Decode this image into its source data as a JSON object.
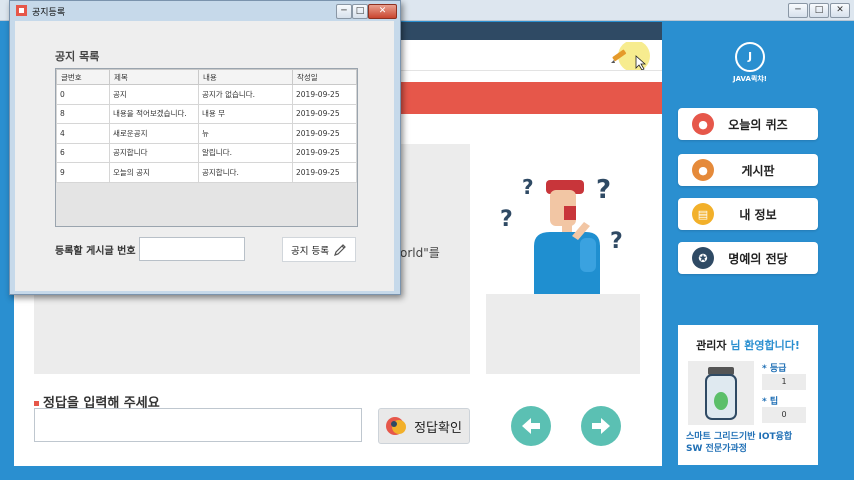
{
  "main_window": {
    "title_buttons": [
      "─",
      "□",
      "✕"
    ],
    "question_fragment": "orld\"를",
    "answer_label": "정답을 입력해 주세요",
    "answer_value": "",
    "check_button": "정답확인",
    "nav_prev_icon": "arrow-left-icon",
    "nav_next_icon": "arrow-right-icon"
  },
  "sidebar": {
    "logo_text": "JAVA퀵챠!",
    "menu": [
      {
        "label": "오늘의 퀴즈",
        "icon": "quiz-avatar-icon",
        "color": "#e6574a"
      },
      {
        "label": "게시판",
        "icon": "board-avatar-icon",
        "color": "#e58a3a"
      },
      {
        "label": "내 정보",
        "icon": "document-icon",
        "color": "#f2b02a"
      },
      {
        "label": "명예의 전당",
        "icon": "medal-icon",
        "color": "#2f4a64"
      }
    ],
    "profile": {
      "user": "관리자",
      "welcome": "님 환영합니다!",
      "grade_label": "등급",
      "grade_value": "1",
      "tip_label": "팁",
      "tip_value": "0",
      "course_line1": "스마트 그리드기반 IOT융합",
      "course_line2": "SW 전문가과정"
    }
  },
  "dialog": {
    "title": "공지등록",
    "title_buttons": [
      "─",
      "□",
      "✕"
    ],
    "list_title": "공지 목록",
    "columns": [
      "글번호",
      "제목",
      "내용",
      "작성일"
    ],
    "rows": [
      [
        "0",
        "공지",
        "공지가 없습니다.",
        "2019-09-25"
      ],
      [
        "8",
        "내용을 적어보겠습니다.",
        "내용 무",
        "2019-09-25"
      ],
      [
        "4",
        "새로운공지",
        "뉴",
        "2019-09-25"
      ],
      [
        "6",
        "공지합니다",
        "알립니다.",
        "2019-09-25"
      ],
      [
        "9",
        "오늘의 공지",
        "공지합니다.",
        "2019-09-25"
      ]
    ],
    "number_label": "등록할 게시글 번호",
    "number_value": "",
    "register_button": "공지 등록"
  },
  "colors": {
    "primary_blue": "#2a8fd0",
    "header_navy": "#2f4a64",
    "banner_red": "#e6574a",
    "nav_teal": "#5bc0b3"
  }
}
